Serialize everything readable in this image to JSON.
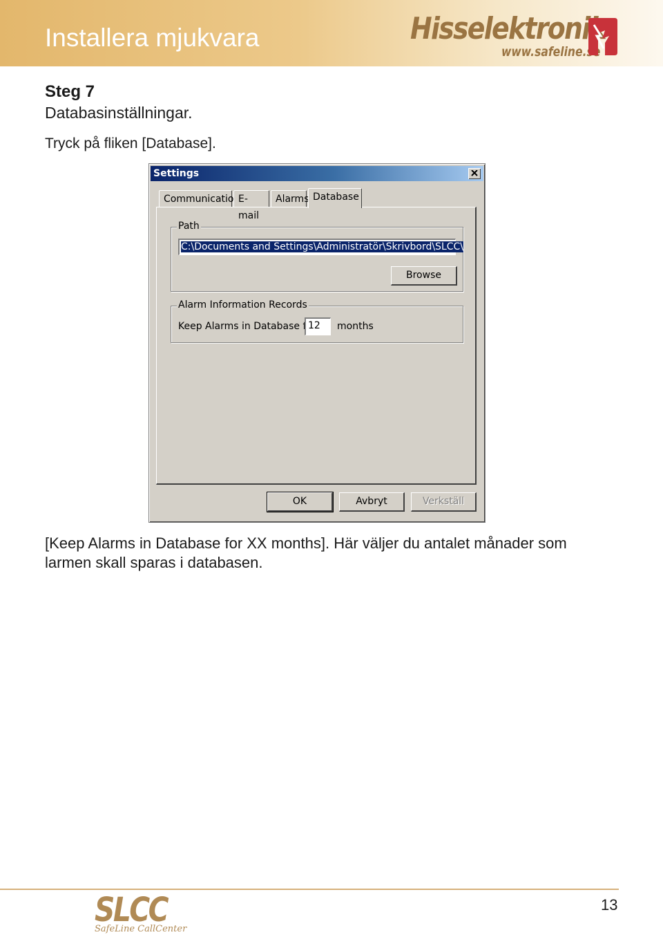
{
  "header": {
    "title": "Installera mjukvara",
    "logo_text": "Hisselektronik",
    "logo_url": "www.safeline.se",
    "brand_color": "#9a7442"
  },
  "content": {
    "step_heading": "Steg 7",
    "step_subtitle": "Databasinställningar.",
    "instruction": "Tryck på fliken [Database].",
    "caption": "[Keep Alarms in Database for XX months]. Här väljer du antalet månader som larmen skall sparas i databasen."
  },
  "dialog": {
    "title": "Settings",
    "close_icon": "close-icon",
    "tabs": [
      {
        "label": "Communication",
        "active": false
      },
      {
        "label": "E-mail",
        "active": false
      },
      {
        "label": "Alarms",
        "active": false
      },
      {
        "label": "Database",
        "active": true
      }
    ],
    "path_group": {
      "legend": "Path",
      "value": "C:\\Documents and Settings\\Administratör\\Skrivbord\\SLCC\\",
      "browse_label": "Browse"
    },
    "alarm_group": {
      "legend": "Alarm Information Records",
      "keep_label": "Keep Alarms in Database for",
      "months_value": "12",
      "months_unit": "months"
    },
    "buttons": {
      "ok": "OK",
      "cancel": "Avbryt",
      "apply": "Verkställ"
    }
  },
  "footer": {
    "logo_text": "SLCC",
    "logo_subtitle": "SafeLine CallCenter",
    "page_number": "13"
  }
}
